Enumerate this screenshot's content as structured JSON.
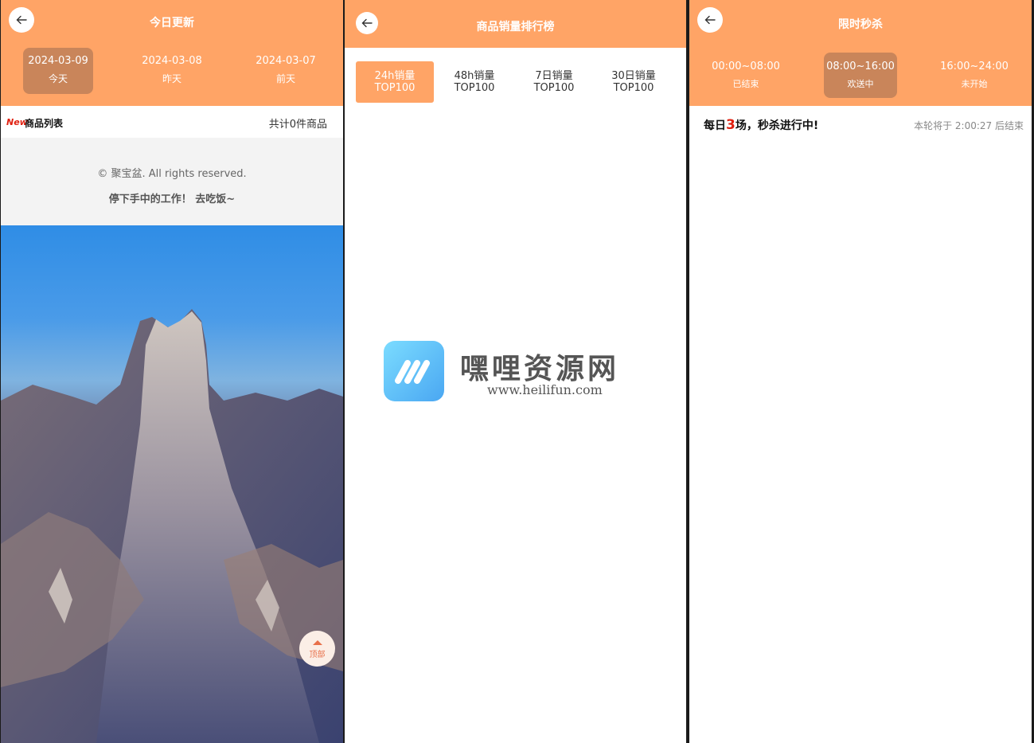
{
  "panel1": {
    "title": "今日更新",
    "dates": [
      {
        "date": "2024-03-09",
        "label": "今天",
        "active": true
      },
      {
        "date": "2024-03-08",
        "label": "昨天",
        "active": false
      },
      {
        "date": "2024-03-07",
        "label": "前天",
        "active": false
      }
    ],
    "list": {
      "badge": "New",
      "title": "商品列表",
      "count": "共计0件商品"
    },
    "footer": {
      "copyright": "© 聚宝盆. All rights reserved.",
      "slogan": "停下手中的工作！ 去吃饭~"
    },
    "top_button": "顶部"
  },
  "panel2": {
    "title": "商品销量排行榜",
    "tabs": [
      {
        "line1": "24h销量",
        "line2": "TOP100",
        "active": true
      },
      {
        "line1": "48h销量",
        "line2": "TOP100",
        "active": false
      },
      {
        "line1": "7日销量",
        "line2": "TOP100",
        "active": false
      },
      {
        "line1": "30日销量",
        "line2": "TOP100",
        "active": false
      }
    ],
    "watermark": {
      "name": "嘿哩资源网",
      "url": "www.heilifun.com"
    }
  },
  "panel3": {
    "title": "限时秒杀",
    "slots": [
      {
        "time": "00:00~08:00",
        "status": "已结束",
        "active": false
      },
      {
        "time": "08:00~16:00",
        "status": "欢送中",
        "active": true
      },
      {
        "time": "16:00~24:00",
        "status": "未开始",
        "active": false
      }
    ],
    "flash": {
      "prefix": "每日",
      "count": "3",
      "suffix": "场，秒杀进行中!",
      "timer": "本轮将于 2:00:27 后结束"
    }
  },
  "colors": {
    "header": "#ffa466",
    "active_tab": "#c9855a",
    "highlight": "#e02010"
  }
}
